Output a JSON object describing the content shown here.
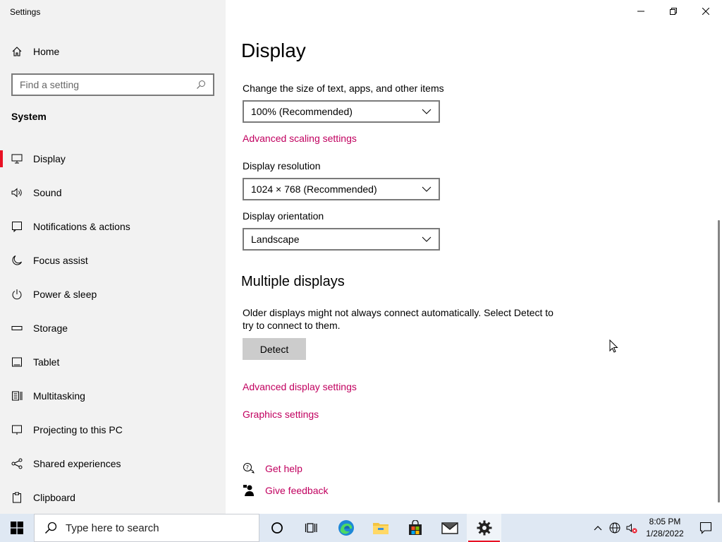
{
  "window": {
    "app_title": "Settings"
  },
  "sidebar": {
    "home_label": "Home",
    "search_placeholder": "Find a setting",
    "section_title": "System",
    "items": [
      {
        "label": "Display",
        "icon": "monitor-icon"
      },
      {
        "label": "Sound",
        "icon": "speaker-icon"
      },
      {
        "label": "Notifications & actions",
        "icon": "notifications-icon"
      },
      {
        "label": "Focus assist",
        "icon": "moon-icon"
      },
      {
        "label": "Power & sleep",
        "icon": "power-icon"
      },
      {
        "label": "Storage",
        "icon": "storage-icon"
      },
      {
        "label": "Tablet",
        "icon": "tablet-icon"
      },
      {
        "label": "Multitasking",
        "icon": "multitasking-icon"
      },
      {
        "label": "Projecting to this PC",
        "icon": "project-icon"
      },
      {
        "label": "Shared experiences",
        "icon": "share-icon"
      },
      {
        "label": "Clipboard",
        "icon": "clipboard-icon"
      }
    ],
    "active_index": 0
  },
  "main": {
    "title": "Display",
    "scale_label": "Change the size of text, apps, and other items",
    "scale_value": "100% (Recommended)",
    "advanced_scaling_link": "Advanced scaling settings",
    "resolution_label": "Display resolution",
    "resolution_value": "1024 × 768 (Recommended)",
    "orientation_label": "Display orientation",
    "orientation_value": "Landscape",
    "multiple_displays_heading": "Multiple displays",
    "multiple_displays_desc": "Older displays might not always connect automatically. Select Detect to try to connect to them.",
    "detect_button": "Detect",
    "advanced_display_link": "Advanced display settings",
    "graphics_link": "Graphics settings",
    "get_help_link": "Get help",
    "give_feedback_link": "Give feedback"
  },
  "taskbar": {
    "search_placeholder": "Type here to search",
    "apps": [
      "cortana-icon",
      "task-view-icon",
      "edge-icon",
      "file-explorer-icon",
      "store-icon",
      "mail-icon",
      "settings-icon"
    ],
    "active_app": "settings-icon",
    "time": "8:05 PM",
    "date": "1/28/2022"
  },
  "colors": {
    "accent": "#e81123",
    "link": "#c1005f",
    "sidebar_bg": "#f2f2f2",
    "taskbar_bg": "#dfe8f3"
  }
}
